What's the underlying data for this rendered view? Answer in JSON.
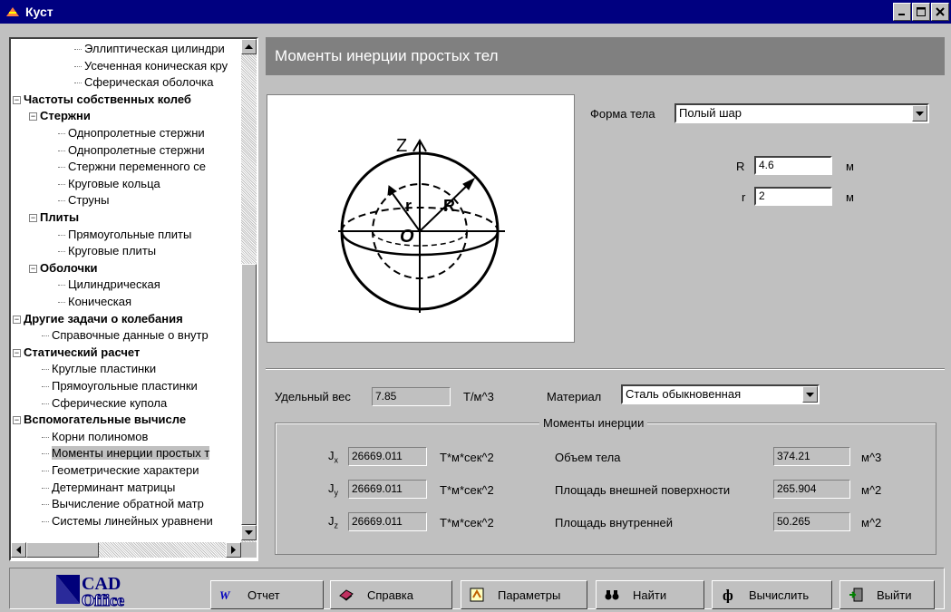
{
  "window": {
    "title": "Куст"
  },
  "tree": {
    "items": [
      {
        "label": "Эллиптическая цилиндри",
        "level": 3,
        "bold": false,
        "expander": ""
      },
      {
        "label": "Усеченная коническая кру",
        "level": 3,
        "bold": false,
        "expander": ""
      },
      {
        "label": "Сферическая оболочка",
        "level": 3,
        "bold": false,
        "expander": ""
      },
      {
        "label": "Частоты собственных колеб",
        "level": 0,
        "bold": true,
        "expander": "−"
      },
      {
        "label": "Стержни",
        "level": 1,
        "bold": true,
        "expander": "−"
      },
      {
        "label": "Однопролетные стержни",
        "level": 2,
        "bold": false,
        "expander": ""
      },
      {
        "label": "Однопролетные стержни",
        "level": 2,
        "bold": false,
        "expander": ""
      },
      {
        "label": "Стержни переменного се",
        "level": 2,
        "bold": false,
        "expander": ""
      },
      {
        "label": "Круговые кольца",
        "level": 2,
        "bold": false,
        "expander": ""
      },
      {
        "label": "Струны",
        "level": 2,
        "bold": false,
        "expander": ""
      },
      {
        "label": "Плиты",
        "level": 1,
        "bold": true,
        "expander": "−"
      },
      {
        "label": "Прямоугольные плиты",
        "level": 2,
        "bold": false,
        "expander": ""
      },
      {
        "label": "Круговые плиты",
        "level": 2,
        "bold": false,
        "expander": ""
      },
      {
        "label": "Оболочки",
        "level": 1,
        "bold": true,
        "expander": "−"
      },
      {
        "label": "Цилиндрическая",
        "level": 2,
        "bold": false,
        "expander": ""
      },
      {
        "label": "Коническая",
        "level": 2,
        "bold": false,
        "expander": ""
      },
      {
        "label": "Другие задачи о колебания",
        "level": 0,
        "bold": true,
        "expander": "−"
      },
      {
        "label": "Справочные данные о внутр",
        "level": 1,
        "bold": false,
        "expander": ""
      },
      {
        "label": "Статический расчет",
        "level": 0,
        "bold": true,
        "expander": "−"
      },
      {
        "label": "Круглые пластинки",
        "level": 1,
        "bold": false,
        "expander": ""
      },
      {
        "label": "Прямоугольные пластинки",
        "level": 1,
        "bold": false,
        "expander": ""
      },
      {
        "label": "Сферические купола",
        "level": 1,
        "bold": false,
        "expander": ""
      },
      {
        "label": "Вспомогательные вычисле",
        "level": 0,
        "bold": true,
        "expander": "−"
      },
      {
        "label": "Корни полиномов",
        "level": 1,
        "bold": false,
        "expander": ""
      },
      {
        "label": "Моменты инерции простых т",
        "level": 1,
        "bold": false,
        "expander": "",
        "selected": true
      },
      {
        "label": "Геометрические характери",
        "level": 1,
        "bold": false,
        "expander": ""
      },
      {
        "label": "Детерминант матрицы",
        "level": 1,
        "bold": false,
        "expander": ""
      },
      {
        "label": "Вычисление обратной матр",
        "level": 1,
        "bold": false,
        "expander": ""
      },
      {
        "label": "Системы линейных уравнени",
        "level": 1,
        "bold": false,
        "expander": ""
      }
    ]
  },
  "panel": {
    "title": "Моменты инерции простых тел"
  },
  "diagram": {
    "z": "Z",
    "r": "r",
    "R": "R",
    "o": "O"
  },
  "shape": {
    "label": "Форма тела",
    "value": "Полый шар"
  },
  "params": {
    "R_label": "R",
    "R_value": "4.6",
    "R_unit": "м",
    "r_label": "r",
    "r_value": "2",
    "r_unit": "м"
  },
  "weight": {
    "label": "Удельный вес",
    "value": "7.85",
    "unit": "Т/м^3"
  },
  "material": {
    "label": "Материал",
    "value": "Сталь обыкновенная"
  },
  "moments": {
    "group_title": "Моменты инерции",
    "jx_label": "J",
    "jx_sub": "x",
    "jx_value": "26669.011",
    "jx_unit": "Т*м*сек^2",
    "jy_label": "J",
    "jy_sub": "y",
    "jy_value": "26669.011",
    "jy_unit": "Т*м*сек^2",
    "jz_label": "J",
    "jz_sub": "z",
    "jz_value": "26669.011",
    "jz_unit": "Т*м*сек^2",
    "volume_label": "Объем тела",
    "volume_value": "374.21",
    "volume_unit": "м^3",
    "outer_label": "Площадь внешней поверхности",
    "outer_value": "265.904",
    "outer_unit": "м^2",
    "inner_label": "Площадь внутренней",
    "inner_value": "50.265",
    "inner_unit": "м^2"
  },
  "logo": {
    "line1": "CAD",
    "line2": "Office"
  },
  "toolbar": {
    "report": "Отчет",
    "help": "Справка",
    "params": "Параметры",
    "find": "Найти",
    "calc": "Вычислить",
    "exit": "Выйти"
  }
}
